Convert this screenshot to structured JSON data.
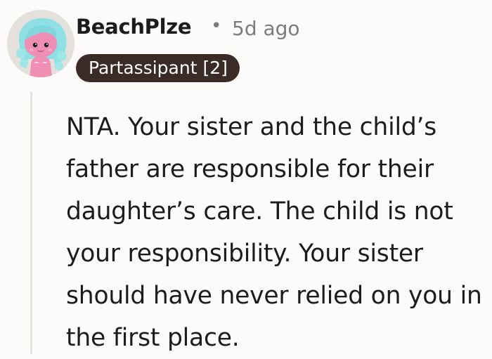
{
  "comment": {
    "author": "BeachPlze",
    "separator": "•",
    "timestamp": "5d ago",
    "flair": "Partassipant [2]",
    "body": "NTA. Your sister and the child’s father are responsible for their daughter’s care. The child is not your responsibility. Your sister should have never relied on you in the first place."
  },
  "avatar": {
    "icon": "snoo-avatar-icon",
    "background_color": "#e4e1dc",
    "skin_color": "#ef8fb4",
    "hair_color": "#8ee0e4"
  },
  "colors": {
    "flair_background": "#3b2b27",
    "flair_text": "#ffffff",
    "meta_text": "#7c7c7c",
    "thread_line": "#e7e4df",
    "page_background": "#fcfbfa"
  }
}
